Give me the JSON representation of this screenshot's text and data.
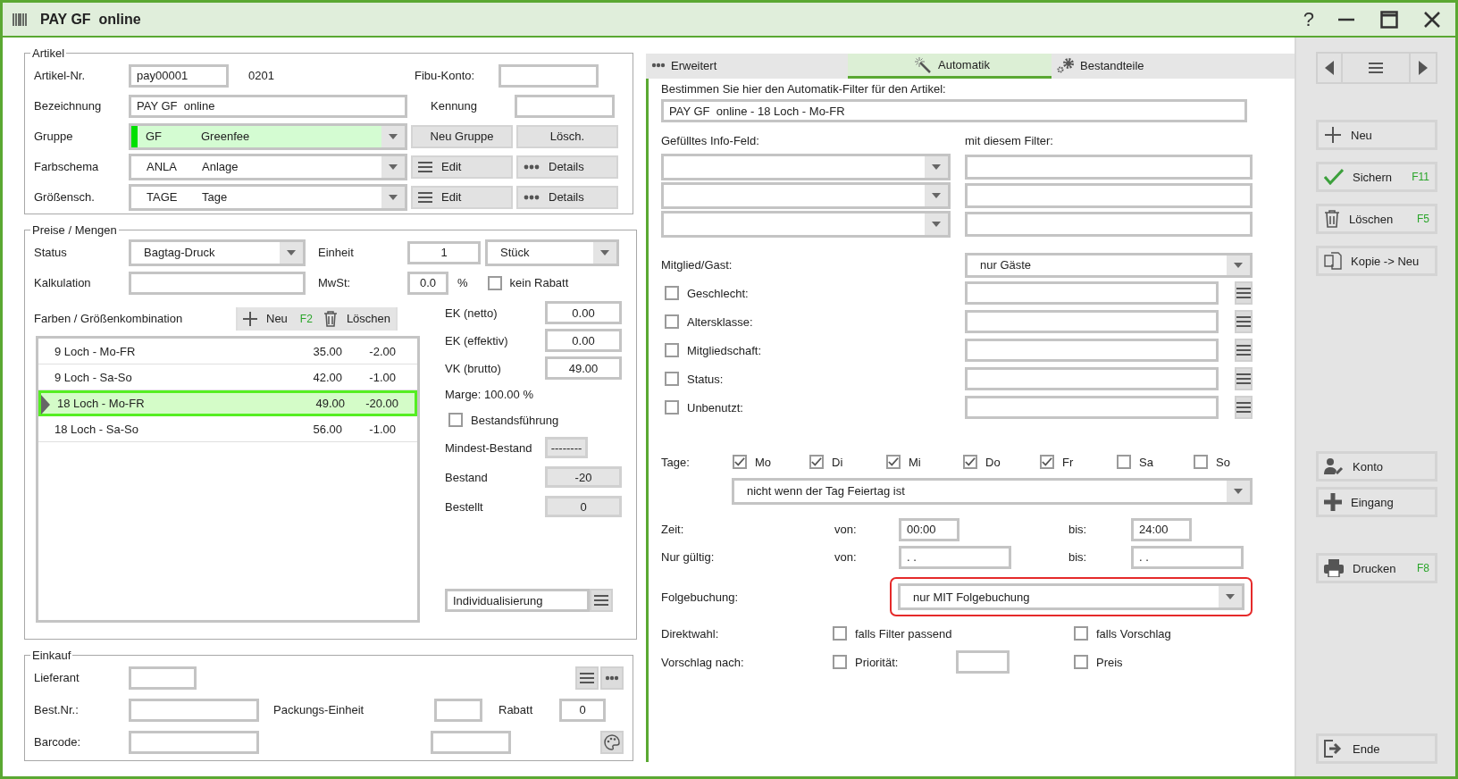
{
  "window": {
    "title": "PAY GF  online",
    "help": "?"
  },
  "artikel": {
    "legend": "Artikel",
    "nr": {
      "label": "Artikel-Nr.",
      "value": "pay00001",
      "code": "0201"
    },
    "fibu": {
      "label": "Fibu-Konto:"
    },
    "bezeichnung": {
      "label": "Bezeichnung",
      "value": "PAY GF  online"
    },
    "kennung": {
      "label": "Kennung"
    },
    "selects": [
      {
        "label": "Gruppe",
        "code": "GF",
        "name": "Greenfee",
        "color": "#00e000",
        "highlighted": true,
        "buttons": [
          {
            "kind": "plain",
            "label": "Neu Gruppe"
          },
          {
            "kind": "plain",
            "label": "Lösch."
          }
        ]
      },
      {
        "label": "Farbschema",
        "code": "ANLA",
        "name": "Anlage",
        "highlighted": false,
        "buttons": [
          {
            "kind": "list",
            "label": "Edit"
          },
          {
            "kind": "more",
            "label": "Details"
          }
        ]
      },
      {
        "label": "Größensch.",
        "code": "TAGE",
        "name": "Tage",
        "highlighted": false,
        "buttons": [
          {
            "kind": "list",
            "label": "Edit"
          },
          {
            "kind": "more",
            "label": "Details"
          }
        ]
      }
    ]
  },
  "preise": {
    "legend": "Preise / Mengen",
    "status": {
      "label": "Status",
      "value": "Bagtag-Druck"
    },
    "einheit": {
      "label": "Einheit",
      "value": "1",
      "unit": "Stück"
    },
    "kalkulation": {
      "label": "Kalkulation"
    },
    "mwst": {
      "label": "MwSt:",
      "value": "0.0",
      "suffix": "%"
    },
    "kein_rabatt": {
      "label": "kein Rabatt",
      "checked": false
    },
    "kombination": {
      "label": "Farben / Größenkombination",
      "neu": {
        "label": "Neu",
        "key": "F2"
      },
      "loeschen": {
        "label": "Löschen"
      },
      "rows": [
        {
          "name": "9 Loch - Mo-FR",
          "price": "35.00",
          "delta": "-2.00",
          "selected": false
        },
        {
          "name": "9 Loch - Sa-So",
          "price": "42.00",
          "delta": "-1.00",
          "selected": false
        },
        {
          "name": "18 Loch - Mo-FR",
          "price": "49.00",
          "delta": "-20.00",
          "selected": true
        },
        {
          "name": "18 Loch - Sa-So",
          "price": "56.00",
          "delta": "-1.00",
          "selected": false
        }
      ]
    },
    "prices": [
      {
        "label": "EK (netto)",
        "value": "0.00"
      },
      {
        "label": "EK (effektiv)",
        "value": "0.00"
      },
      {
        "label": "VK (brutto)",
        "value": "49.00"
      }
    ],
    "marge": "Marge: 100.00 %",
    "bestandsfuehrung": {
      "label": "Bestandsführung",
      "checked": false
    },
    "stock": [
      {
        "label": "Mindest-Bestand",
        "value": "--------"
      },
      {
        "label": "Bestand",
        "value": "-20"
      },
      {
        "label": "Bestellt",
        "value": "0"
      }
    ],
    "individualisierung": "Individualisierung"
  },
  "einkauf": {
    "legend": "Einkauf",
    "lieferant": "Lieferant",
    "best_nr": "Best.Nr.:",
    "packungs_einheit": "Packungs-Einheit",
    "rabatt": {
      "label": "Rabatt",
      "value": "0"
    },
    "barcode": "Barcode:"
  },
  "tabs": [
    {
      "label": "Erweitert",
      "kind": "more",
      "selected": false
    },
    {
      "label": "Automatik",
      "kind": "wand",
      "selected": true
    },
    {
      "label": "Bestandteile",
      "kind": "gears",
      "selected": false
    }
  ],
  "automatik": {
    "intro": "Bestimmen Sie hier den Automatik-Filter für den Artikel:",
    "name": "PAY GF  online - 18 Loch - Mo-FR",
    "info_label": "Gefülltes Info-Feld:",
    "filter_label": "mit diesem Filter:",
    "mitglied": {
      "label": "Mitglied/Gast:",
      "value": "nur Gäste"
    },
    "criteria": [
      {
        "label": "Geschlecht:",
        "checked": false
      },
      {
        "label": "Altersklasse:",
        "checked": false
      },
      {
        "label": "Mitgliedschaft:",
        "checked": false
      },
      {
        "label": "Status:",
        "checked": false
      },
      {
        "label": "Unbenutzt:",
        "checked": false
      }
    ],
    "tage": {
      "label": "Tage:",
      "days": [
        {
          "label": "Mo",
          "checked": true
        },
        {
          "label": "Di",
          "checked": true
        },
        {
          "label": "Mi",
          "checked": true
        },
        {
          "label": "Do",
          "checked": true
        },
        {
          "label": "Fr",
          "checked": true
        },
        {
          "label": "Sa",
          "checked": false
        },
        {
          "label": "So",
          "checked": false
        }
      ],
      "holiday": "nicht wenn der Tag Feiertag ist"
    },
    "zeit": {
      "label": "Zeit:",
      "von_label": "von:",
      "von": "00:00",
      "bis_label": "bis:",
      "bis": "24:00"
    },
    "gueltig": {
      "label": "Nur gültig:",
      "von_label": "von:",
      "von": ". .",
      "bis_label": "bis:",
      "bis": ". ."
    },
    "folgebuchung": {
      "label": "Folgebuchung:",
      "value": "nur MIT Folgebuchung",
      "highlighted": true
    },
    "direktwahl": {
      "label": "Direktwahl:",
      "options": [
        {
          "label": "falls Filter passend",
          "checked": false
        },
        {
          "label": "falls Vorschlag",
          "checked": false
        }
      ]
    },
    "vorschlag": {
      "label": "Vorschlag nach:",
      "prioritaet": {
        "label": "Priorität:",
        "checked": false
      },
      "preis": {
        "label": "Preis",
        "checked": false
      }
    }
  },
  "sidebar": {
    "groups": [
      [
        {
          "label": "Neu",
          "kind": "plus"
        },
        {
          "label": "Sichern",
          "kind": "check",
          "key": "F11"
        },
        {
          "label": "Löschen",
          "kind": "trash",
          "key": "F5"
        },
        {
          "label": "Kopie -> Neu",
          "kind": "copy"
        }
      ],
      [
        {
          "label": "Konto",
          "kind": "user"
        },
        {
          "label": "Eingang",
          "kind": "bigplus"
        }
      ],
      [
        {
          "label": "Drucken",
          "kind": "print",
          "key": "F8"
        }
      ],
      [
        {
          "label": "Ende",
          "kind": "exit"
        }
      ]
    ]
  }
}
